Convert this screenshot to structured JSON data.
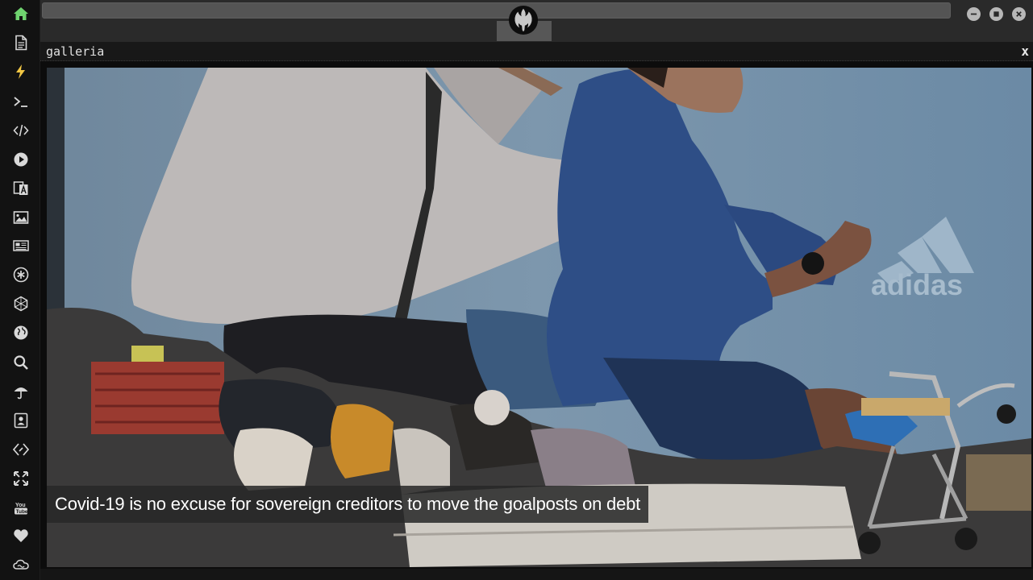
{
  "window": {
    "logo_icon": "rebel-alliance-icon",
    "controls": [
      "minimize-icon",
      "maximize-icon",
      "close-icon"
    ]
  },
  "sidebar": {
    "active_color": "#6fd36f",
    "items": [
      {
        "icon": "home-icon"
      },
      {
        "icon": "document-icon"
      },
      {
        "icon": "lightning-icon"
      },
      {
        "icon": "terminal-icon"
      },
      {
        "icon": "code-icon"
      },
      {
        "icon": "play-icon"
      },
      {
        "icon": "translate-icon"
      },
      {
        "icon": "image-icon"
      },
      {
        "icon": "newspaper-icon"
      },
      {
        "icon": "asterisk-icon"
      },
      {
        "icon": "hexagon-icon"
      },
      {
        "icon": "globe-icon"
      },
      {
        "icon": "search-icon"
      },
      {
        "icon": "umbrella-icon"
      },
      {
        "icon": "contact-card-icon"
      },
      {
        "icon": "api-icon"
      },
      {
        "icon": "expand-icon"
      },
      {
        "icon": "youtube-icon"
      },
      {
        "icon": "heart-icon"
      },
      {
        "icon": "cloud-icon"
      }
    ]
  },
  "panel": {
    "title": "galleria",
    "close_label": "x"
  },
  "gallery": {
    "caption": "Covid-19 is no excuse for sovereign creditors to move the goalposts on debt",
    "billboard_text": "adidas"
  }
}
